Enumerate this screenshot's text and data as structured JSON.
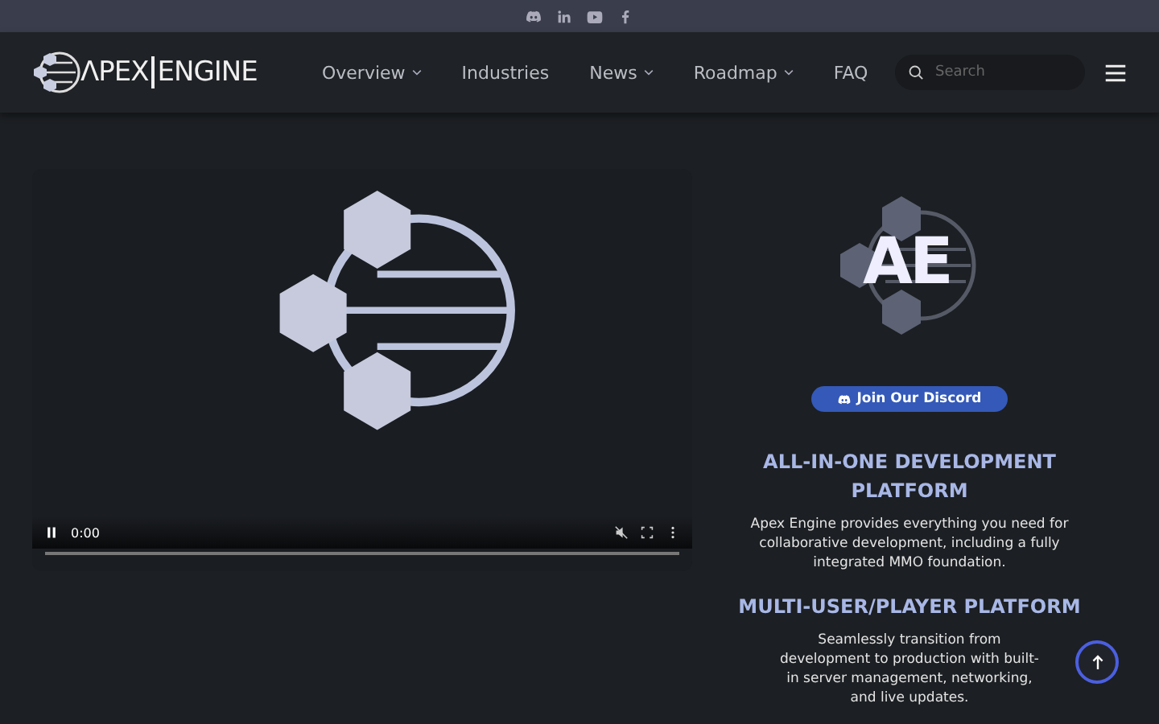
{
  "header": {
    "logo": {
      "left": "ΛPEX",
      "right": "ENGINE"
    },
    "nav": [
      {
        "label": "Overview",
        "dropdown": true
      },
      {
        "label": "Industries",
        "dropdown": false
      },
      {
        "label": "News",
        "dropdown": true
      },
      {
        "label": "Roadmap",
        "dropdown": true
      },
      {
        "label": "FAQ",
        "dropdown": false
      }
    ],
    "search": {
      "placeholder": "Search"
    }
  },
  "video": {
    "playing": true,
    "time": "0:00"
  },
  "sidebar": {
    "logo": "AE",
    "discord_button": "Join Our Discord",
    "sections": [
      {
        "title": "ALL-IN-ONE DEVELOPMENT PLATFORM",
        "text": "Apex Engine provides everything you need for collaborative development, including a fully integrated MMO foundation."
      },
      {
        "title": "MULTI-USER/PLAYER PLATFORM",
        "text": "Seamlessly transition from development to production with built-in server management, networking, and live updates."
      }
    ]
  }
}
